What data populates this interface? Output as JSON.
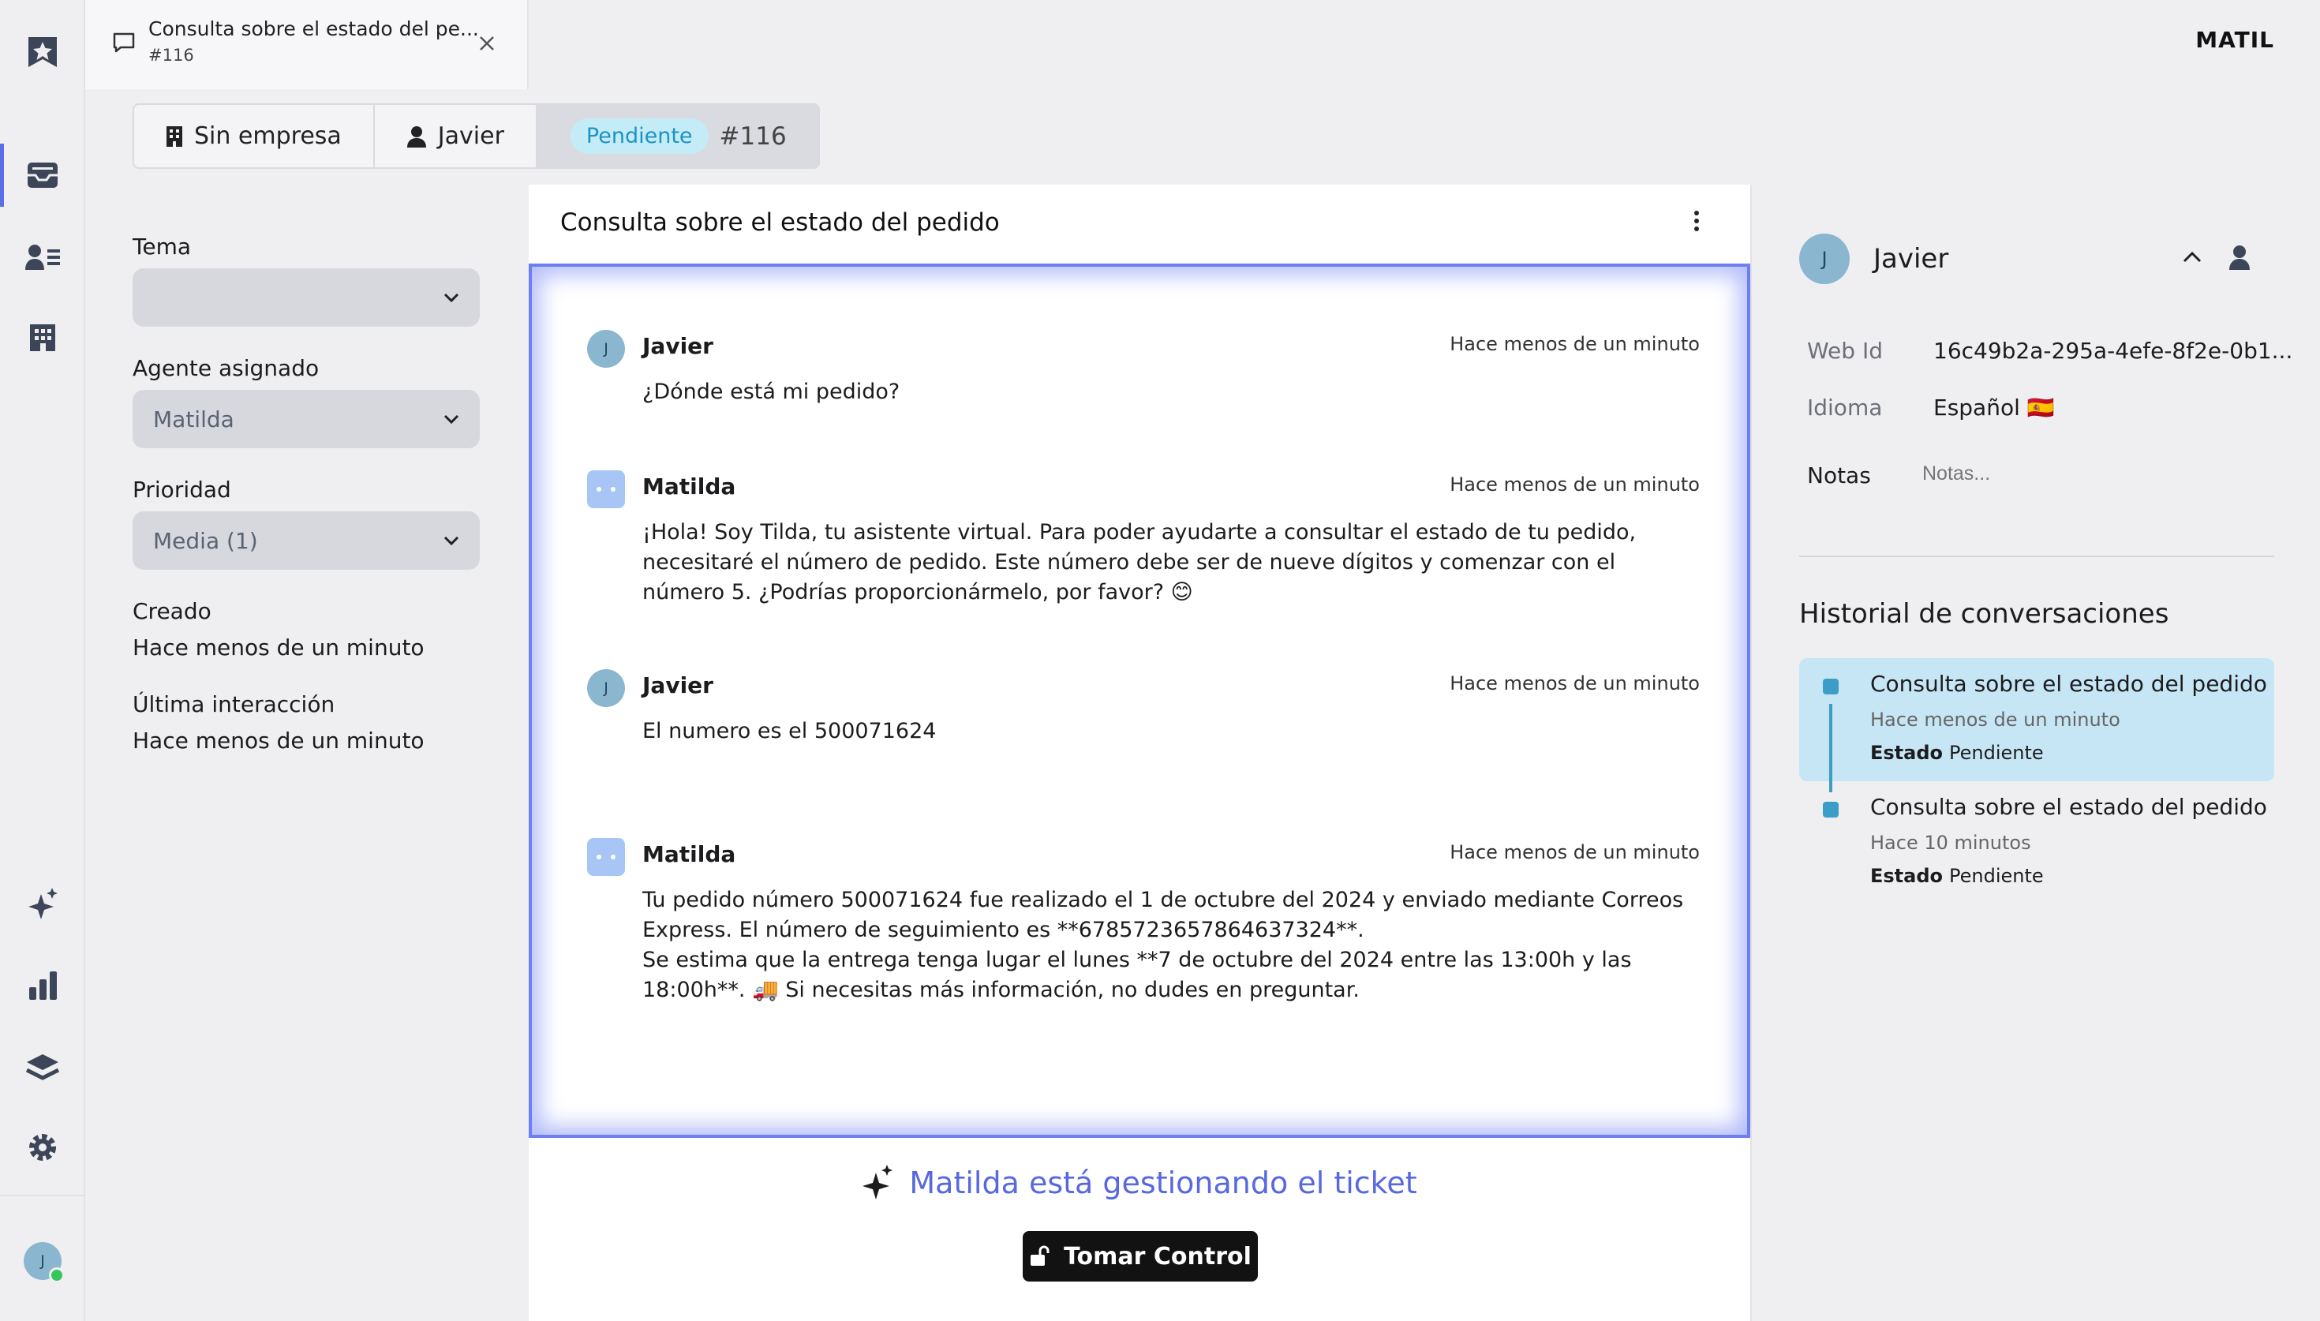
{
  "tab": {
    "title": "Consulta sobre el estado del pe...",
    "subtitle": "#116"
  },
  "brand": "MATIL",
  "breadcrumbs": {
    "company": "Sin empresa",
    "contact": "Javier",
    "status": "Pendiente",
    "ticket": "#116"
  },
  "fields": {
    "tema_label": "Tema",
    "tema_value": "",
    "agente_label": "Agente asignado",
    "agente_value": "Matilda",
    "prioridad_label": "Prioridad",
    "prioridad_value": "Media (1)",
    "creado_label": "Creado",
    "creado_value": "Hace menos de un minuto",
    "ultima_label": "Última interacción",
    "ultima_value": "Hace menos de un minuto"
  },
  "chat": {
    "title": "Consulta sobre el estado del pedido",
    "messages": [
      {
        "author": "Javier",
        "avatar": "J",
        "time": "Hace menos de un minuto",
        "text": "¿Dónde está mi pedido?"
      },
      {
        "author": "Matilda",
        "time": "Hace menos de un minuto",
        "text": "¡Hola! Soy Tilda, tu asistente virtual. Para poder ayudarte a consultar el estado de tu pedido, necesitaré el número de pedido. Este número debe ser de nueve dígitos y comenzar con el número 5. ¿Podrías proporcionármelo, por favor? 😊"
      },
      {
        "author": "Javier",
        "avatar": "J",
        "time": "Hace menos de un minuto",
        "text": "El numero es el 500071624"
      },
      {
        "author": "Matilda",
        "time": "Hace menos de un minuto",
        "text1": "Tu pedido número 500071624 fue realizado el 1 de octubre del 2024 y enviado mediante Correos Express. El número de seguimiento es **6785723657864637324**.",
        "text2": "Se estima que la entrega tenga lugar el lunes **7 de octubre del 2024 entre las 13:00h y las 18:00h**. 🚚 Si necesitas más información, no dudes en preguntar."
      }
    ],
    "handling_text": "Matilda está gestionando el ticket",
    "take_control_label": "Tomar Control"
  },
  "contact": {
    "avatar": "J",
    "name": "Javier",
    "webid_label": "Web Id",
    "webid_value": "16c49b2a-295a-4efe-8f2e-0b1...",
    "idioma_label": "Idioma",
    "idioma_value": "Español 🇪🇸",
    "notas_label": "Notas",
    "notas_placeholder": "Notas..."
  },
  "history": {
    "title": "Historial de conversaciones",
    "state_label": "Estado",
    "items": [
      {
        "title": "Consulta sobre el estado del pedido",
        "time": "Hace menos de un minuto",
        "state": "Pendiente"
      },
      {
        "title": "Consulta sobre el estado del pedido",
        "time": "Hace 10 minutos",
        "state": "Pendiente"
      }
    ]
  },
  "user_avatar": "J",
  "colors": {
    "accent": "#5b6ee8",
    "status_pill_bg": "#c4ecf7",
    "status_pill_text": "#1d93c4",
    "online": "#34c759"
  }
}
